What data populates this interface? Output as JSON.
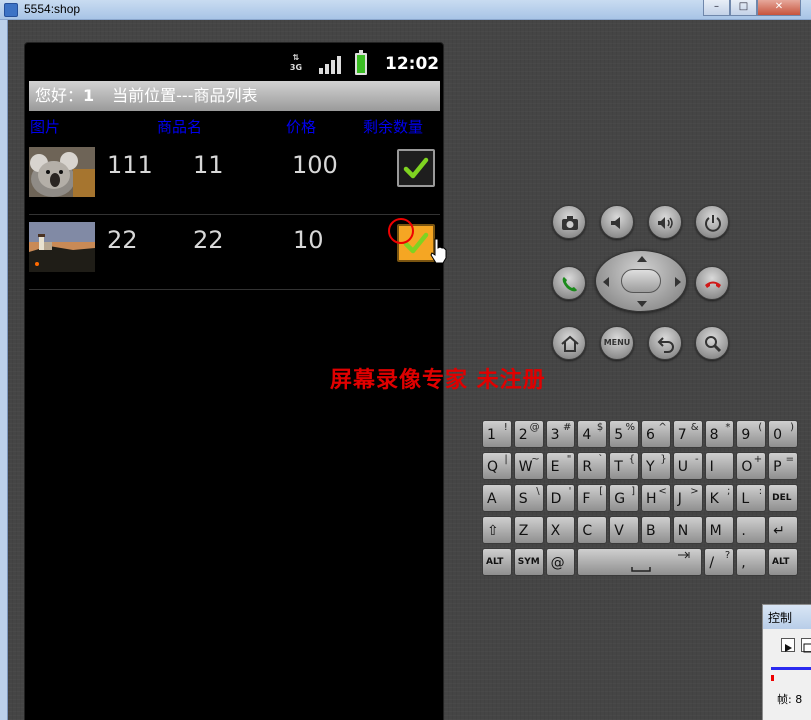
{
  "window": {
    "title": "5554:shop",
    "buttons": {
      "minimize": "–",
      "maximize": "□",
      "close": "✕"
    }
  },
  "statusbar": {
    "network": "3G",
    "time": "12:02"
  },
  "header": {
    "greeting_label": "您好：",
    "user_name": "1",
    "location": "当前位置---商品列表"
  },
  "table": {
    "columns": [
      "图片",
      "商品名",
      "价格",
      "剩余数量"
    ],
    "rows": [
      {
        "image": "koala",
        "id": "111",
        "name": "11",
        "price": "100",
        "checked": true,
        "focused": false
      },
      {
        "image": "lighthouse",
        "id": "22",
        "name": "22",
        "price": "10",
        "checked": true,
        "focused": true
      }
    ]
  },
  "watermark": "屏幕录像专家  未注册",
  "emulator_buttons": [
    "camera-icon",
    "volume-down-icon",
    "volume-up-icon",
    "power-icon",
    "call-icon",
    "end-call-icon",
    "home-icon",
    "menu",
    "back-icon",
    "search-icon"
  ],
  "menu_label": "MENU",
  "keyboard": {
    "row1": [
      [
        "1",
        "!"
      ],
      [
        "2",
        "@"
      ],
      [
        "3",
        "#"
      ],
      [
        "4",
        "$"
      ],
      [
        "5",
        "%"
      ],
      [
        "6",
        "^"
      ],
      [
        "7",
        "&"
      ],
      [
        "8",
        "*"
      ],
      [
        "9",
        "("
      ],
      [
        "0",
        ")"
      ]
    ],
    "row2": [
      [
        "Q",
        "|"
      ],
      [
        "W",
        "~"
      ],
      [
        "E",
        "\""
      ],
      [
        "R",
        "`"
      ],
      [
        "T",
        "{"
      ],
      [
        "Y",
        "}"
      ],
      [
        "U",
        "-"
      ],
      [
        "I",
        ""
      ],
      [
        "O",
        "+"
      ],
      [
        "P",
        "="
      ]
    ],
    "row3": [
      [
        "A",
        ""
      ],
      [
        "S",
        "\\"
      ],
      [
        "D",
        "'"
      ],
      [
        "F",
        "["
      ],
      [
        "G",
        "]"
      ],
      [
        "H",
        "<"
      ],
      [
        "J",
        ">"
      ],
      [
        "K",
        ";"
      ],
      [
        "L",
        ":"
      ],
      [
        "DEL",
        ""
      ]
    ],
    "row4": [
      [
        "⇧",
        ""
      ],
      [
        "Z",
        ""
      ],
      [
        "X",
        ""
      ],
      [
        "C",
        ""
      ],
      [
        "V",
        ""
      ],
      [
        "B",
        ""
      ],
      [
        "N",
        ""
      ],
      [
        "M",
        ""
      ],
      [
        ".",
        ""
      ],
      [
        "↵",
        ""
      ]
    ],
    "row5": {
      "alt": "ALT",
      "sym": "SYM",
      "at": "@",
      "slash": "/",
      "slash_alt": "?",
      "comma": ",",
      "alt2": "ALT"
    }
  },
  "control_window": {
    "title": "控制",
    "frame_label": "帧: 8"
  },
  "colors": {
    "column_header": "#0000ee",
    "checkmark": "#7fd321",
    "focus": "#f5a623",
    "watermark": "#e00000"
  }
}
